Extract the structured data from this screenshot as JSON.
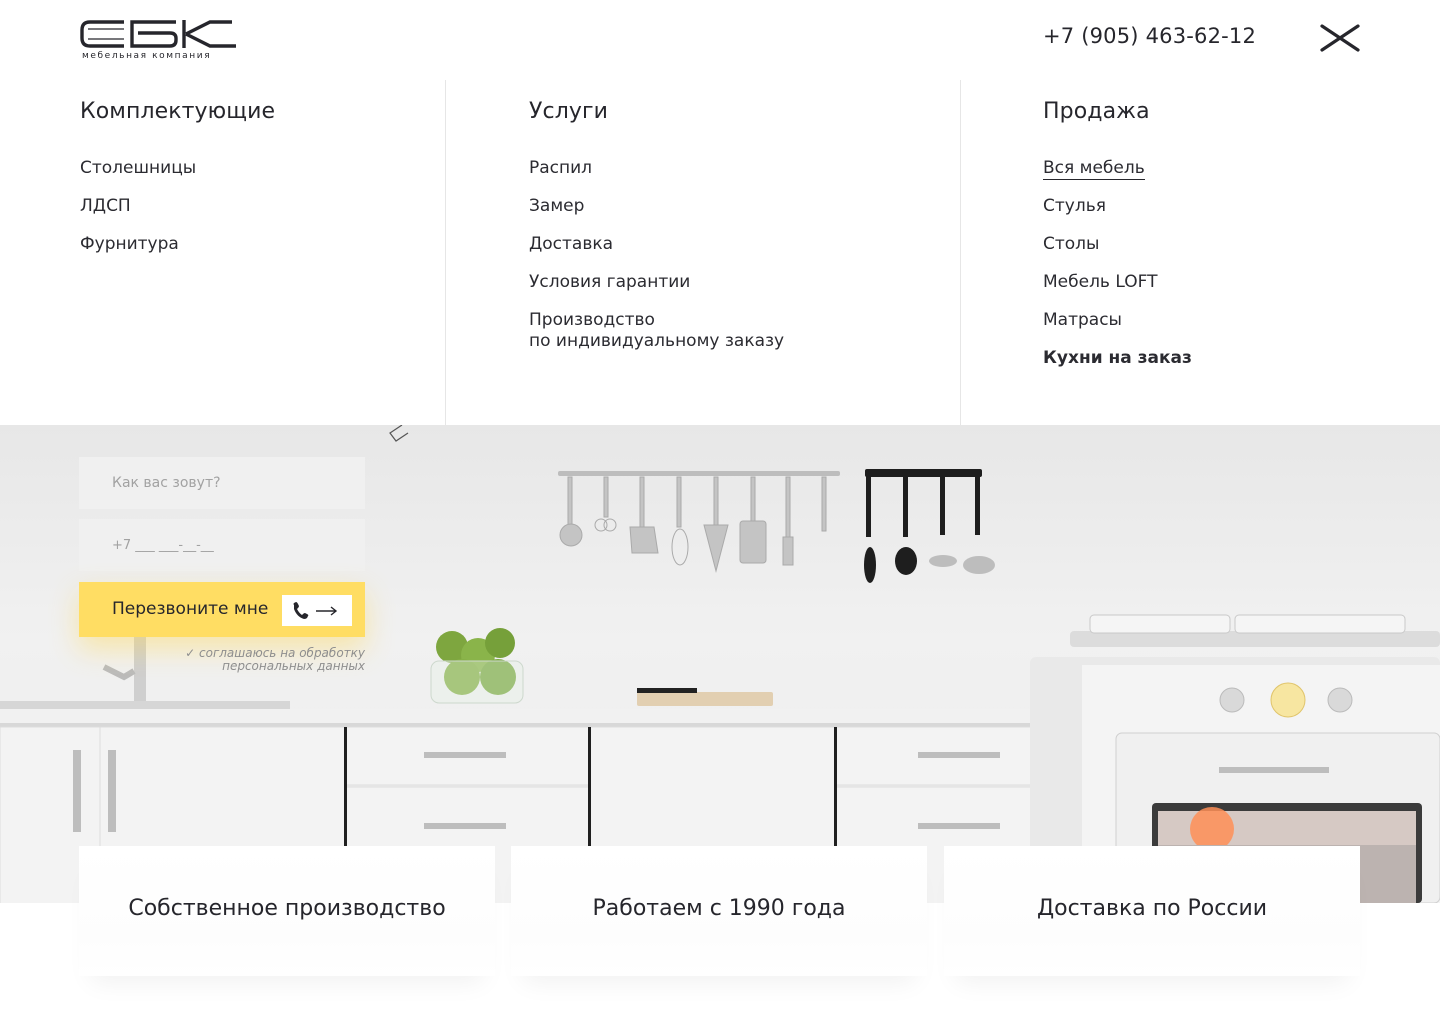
{
  "header": {
    "logo_text": "СБК",
    "logo_subtitle": "мебельная компания",
    "phone": "+7 (905) 463-62-12"
  },
  "menu": {
    "columns": [
      {
        "title": "Комплектующие",
        "items": [
          "Столешницы",
          "ЛДСП",
          "Фурнитура"
        ]
      },
      {
        "title": "Услуги",
        "items": [
          "Распил",
          "Замер",
          "Доставка",
          "Условия гарантии",
          "Производство",
          "по индивидуальному заказу"
        ]
      },
      {
        "title": "Продажа",
        "items": [
          "Вся мебель",
          "Стулья",
          "Столы",
          "Мебель LOFT",
          "Матрасы",
          "Кухни на заказ"
        ],
        "active_item": "Вся мебель",
        "bold_item": "Кухни на заказ"
      }
    ]
  },
  "form": {
    "name_placeholder": "Как вас зовут?",
    "phone_placeholder": "+7 ___ ___-__-__",
    "submit_label": "Перезвоните мне",
    "consent_line1": "соглашаюсь на обработку",
    "consent_line2": "персональных данных",
    "consent_checked": true
  },
  "features": [
    "Собственное производство",
    "Работаем с 1990 года",
    "Доставка по России"
  ],
  "colors": {
    "accent": "#ffdd63",
    "text": "#26262c",
    "field_bg": "#f0f0f0"
  }
}
